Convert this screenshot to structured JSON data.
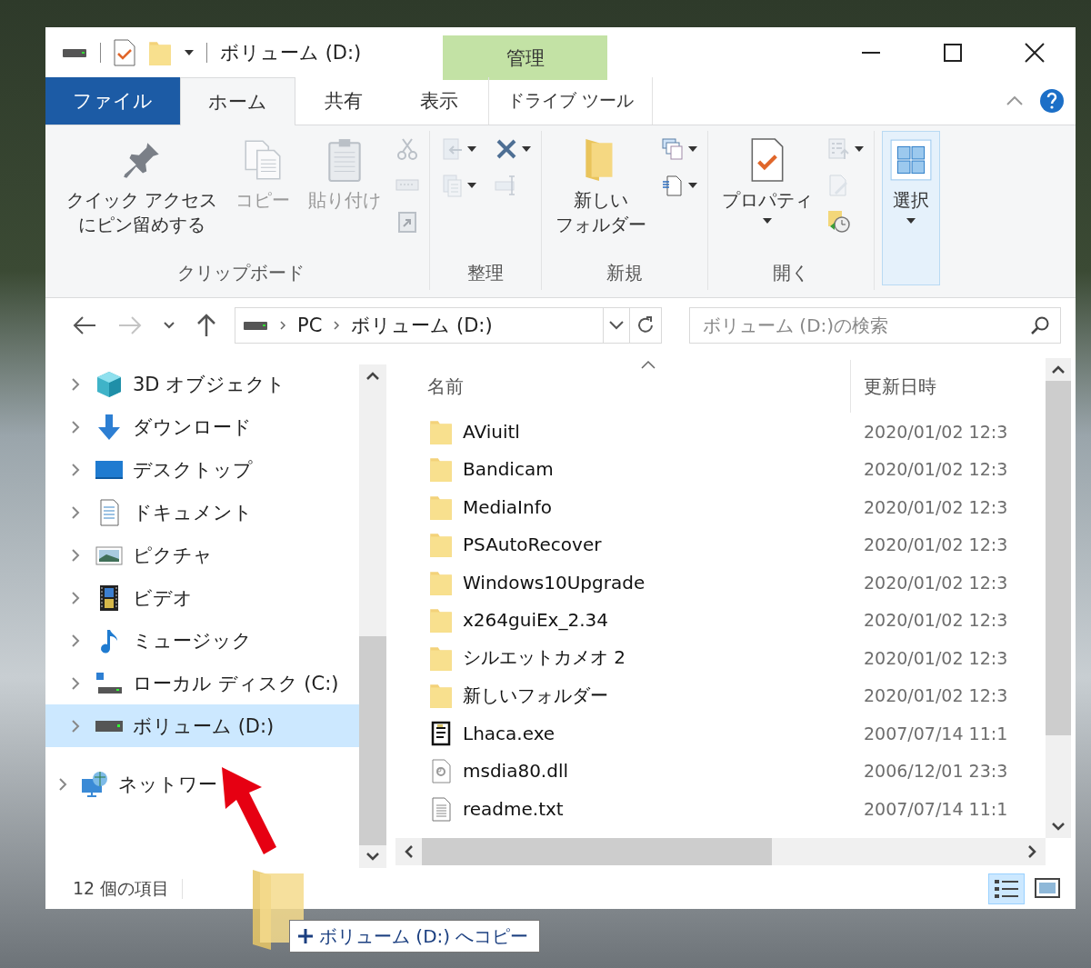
{
  "window": {
    "title": "ボリューム (D:)",
    "context_header": "管理"
  },
  "tabs": [
    {
      "label": "ファイル",
      "kind": "file",
      "selected": false
    },
    {
      "label": "ホーム",
      "kind": "normal",
      "selected": true
    },
    {
      "label": "共有",
      "kind": "normal",
      "selected": false
    },
    {
      "label": "表示",
      "kind": "normal",
      "selected": false
    },
    {
      "label": "ドライブ ツール",
      "kind": "context",
      "selected": false
    }
  ],
  "ribbon": {
    "groups": [
      {
        "label": "クリップボード",
        "big": [
          {
            "kind": "pin",
            "lines": [
              "クイック アクセス",
              "にピン留めする"
            ],
            "disabled": false,
            "dropdown": false
          },
          {
            "kind": "copy",
            "label": "コピー",
            "disabled": true,
            "dropdown": false
          },
          {
            "kind": "paste",
            "label": "貼り付け",
            "disabled": true,
            "dropdown": false
          }
        ],
        "small": [
          {
            "kind": "cut",
            "disabled": true,
            "dropdown": false
          },
          {
            "kind": "copy-path",
            "disabled": true,
            "dropdown": false
          },
          {
            "kind": "paste-shortcut",
            "disabled": true,
            "dropdown": false
          }
        ]
      },
      {
        "label": "整理",
        "small": [
          {
            "kind": "move-to",
            "disabled": true,
            "dropdown": true
          },
          {
            "kind": "copy-to",
            "disabled": true,
            "dropdown": true
          },
          {
            "kind": "delete",
            "disabled": false,
            "dropdown": true
          },
          {
            "kind": "rename",
            "disabled": true,
            "dropdown": false
          }
        ]
      },
      {
        "label": "新規",
        "big": [
          {
            "kind": "new-folder",
            "lines": [
              "新しい",
              "フォルダー"
            ],
            "disabled": false,
            "dropdown": false
          }
        ],
        "small": [
          {
            "kind": "new-item",
            "disabled": false,
            "dropdown": true
          },
          {
            "kind": "easy-access",
            "disabled": false,
            "dropdown": true
          }
        ]
      },
      {
        "label": "開く",
        "big": [
          {
            "kind": "properties",
            "label": "プロパティ",
            "disabled": false,
            "dropdown": true
          }
        ],
        "small": [
          {
            "kind": "open",
            "disabled": true,
            "dropdown": true
          },
          {
            "kind": "edit",
            "disabled": true,
            "dropdown": false
          },
          {
            "kind": "history",
            "disabled": false,
            "dropdown": false
          }
        ]
      },
      {
        "big": [
          {
            "kind": "select",
            "label": "選択",
            "disabled": false,
            "dropdown": true,
            "highlighted": true
          }
        ]
      }
    ]
  },
  "address": {
    "nav": [
      {
        "kind": "back",
        "disabled": false
      },
      {
        "kind": "forward",
        "disabled": true
      },
      {
        "kind": "recent",
        "disabled": false
      },
      {
        "kind": "up",
        "disabled": false
      }
    ],
    "path": [
      "PC",
      "ボリューム (D:)"
    ],
    "search": {
      "placeholder": "ボリューム (D:)の検索"
    }
  },
  "nav": {
    "items": [
      {
        "label": "3D オブジェクト",
        "kind": "cube",
        "selected": false
      },
      {
        "label": "ダウンロード",
        "kind": "downloads",
        "selected": false
      },
      {
        "label": "デスクトップ",
        "kind": "desktop",
        "selected": false
      },
      {
        "label": "ドキュメント",
        "kind": "documents",
        "selected": false
      },
      {
        "label": "ピクチャ",
        "kind": "pictures",
        "selected": false
      },
      {
        "label": "ビデオ",
        "kind": "videos",
        "selected": false
      },
      {
        "label": "ミュージック",
        "kind": "music",
        "selected": false
      },
      {
        "label": "ローカル ディスク (C:)",
        "kind": "localdisk",
        "selected": false
      },
      {
        "label": "ボリューム (D:)",
        "kind": "drive",
        "selected": true
      }
    ],
    "root_items": [
      {
        "label": "ネットワー",
        "kind": "network",
        "selected": false
      }
    ]
  },
  "files": {
    "columns": [
      "名前",
      "更新日時"
    ],
    "rows": [
      {
        "name": "AViuitl",
        "date": "2020/01/02 12:3",
        "kind": "folder"
      },
      {
        "name": "Bandicam",
        "date": "2020/01/02 12:3",
        "kind": "folder"
      },
      {
        "name": "MediaInfo",
        "date": "2020/01/02 12:3",
        "kind": "folder"
      },
      {
        "name": "PSAutoRecover",
        "date": "2020/01/02 12:3",
        "kind": "folder"
      },
      {
        "name": "Windows10Upgrade",
        "date": "2020/01/02 12:3",
        "kind": "folder"
      },
      {
        "name": "x264guiEx_2.34",
        "date": "2020/01/02 12:3",
        "kind": "folder"
      },
      {
        "name": "シルエットカメオ 2",
        "date": "2020/01/02 12:3",
        "kind": "folder"
      },
      {
        "name": "新しいフォルダー",
        "date": "2020/01/02 12:3",
        "kind": "folder"
      },
      {
        "name": "Lhaca.exe",
        "date": "2007/07/14 11:1",
        "kind": "exe"
      },
      {
        "name": "msdia80.dll",
        "date": "2006/12/01 23:3",
        "kind": "dll"
      },
      {
        "name": "readme.txt",
        "date": "2007/07/14 11:1",
        "kind": "txt"
      }
    ]
  },
  "status_bar": {
    "count": "12 個の項目",
    "views": [
      {
        "kind": "details",
        "selected": true
      },
      {
        "kind": "large-icons",
        "selected": false
      }
    ]
  },
  "drag_tooltip": "ボリューム (D:) へコピー"
}
